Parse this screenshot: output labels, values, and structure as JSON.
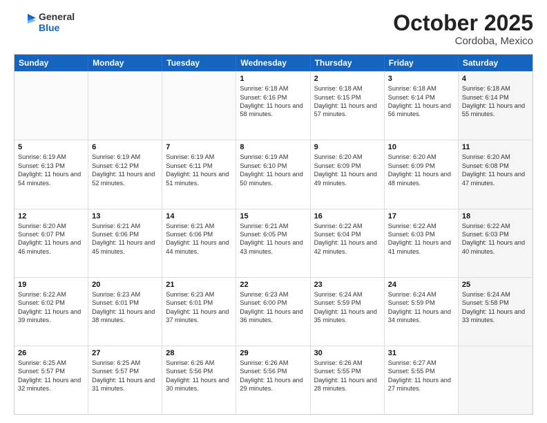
{
  "header": {
    "logo_general": "General",
    "logo_blue": "Blue",
    "month": "October 2025",
    "location": "Cordoba, Mexico"
  },
  "days_of_week": [
    "Sunday",
    "Monday",
    "Tuesday",
    "Wednesday",
    "Thursday",
    "Friday",
    "Saturday"
  ],
  "weeks": [
    [
      {
        "day": "",
        "sunrise": "",
        "sunset": "",
        "daylight": "",
        "shaded": false,
        "empty": true
      },
      {
        "day": "",
        "sunrise": "",
        "sunset": "",
        "daylight": "",
        "shaded": false,
        "empty": true
      },
      {
        "day": "",
        "sunrise": "",
        "sunset": "",
        "daylight": "",
        "shaded": false,
        "empty": true
      },
      {
        "day": "1",
        "sunrise": "Sunrise: 6:18 AM",
        "sunset": "Sunset: 6:16 PM",
        "daylight": "Daylight: 11 hours and 58 minutes.",
        "shaded": false,
        "empty": false
      },
      {
        "day": "2",
        "sunrise": "Sunrise: 6:18 AM",
        "sunset": "Sunset: 6:15 PM",
        "daylight": "Daylight: 11 hours and 57 minutes.",
        "shaded": false,
        "empty": false
      },
      {
        "day": "3",
        "sunrise": "Sunrise: 6:18 AM",
        "sunset": "Sunset: 6:14 PM",
        "daylight": "Daylight: 11 hours and 56 minutes.",
        "shaded": false,
        "empty": false
      },
      {
        "day": "4",
        "sunrise": "Sunrise: 6:18 AM",
        "sunset": "Sunset: 6:14 PM",
        "daylight": "Daylight: 11 hours and 55 minutes.",
        "shaded": true,
        "empty": false
      }
    ],
    [
      {
        "day": "5",
        "sunrise": "Sunrise: 6:19 AM",
        "sunset": "Sunset: 6:13 PM",
        "daylight": "Daylight: 11 hours and 54 minutes.",
        "shaded": false,
        "empty": false
      },
      {
        "day": "6",
        "sunrise": "Sunrise: 6:19 AM",
        "sunset": "Sunset: 6:12 PM",
        "daylight": "Daylight: 11 hours and 52 minutes.",
        "shaded": false,
        "empty": false
      },
      {
        "day": "7",
        "sunrise": "Sunrise: 6:19 AM",
        "sunset": "Sunset: 6:11 PM",
        "daylight": "Daylight: 11 hours and 51 minutes.",
        "shaded": false,
        "empty": false
      },
      {
        "day": "8",
        "sunrise": "Sunrise: 6:19 AM",
        "sunset": "Sunset: 6:10 PM",
        "daylight": "Daylight: 11 hours and 50 minutes.",
        "shaded": false,
        "empty": false
      },
      {
        "day": "9",
        "sunrise": "Sunrise: 6:20 AM",
        "sunset": "Sunset: 6:09 PM",
        "daylight": "Daylight: 11 hours and 49 minutes.",
        "shaded": false,
        "empty": false
      },
      {
        "day": "10",
        "sunrise": "Sunrise: 6:20 AM",
        "sunset": "Sunset: 6:09 PM",
        "daylight": "Daylight: 11 hours and 48 minutes.",
        "shaded": false,
        "empty": false
      },
      {
        "day": "11",
        "sunrise": "Sunrise: 6:20 AM",
        "sunset": "Sunset: 6:08 PM",
        "daylight": "Daylight: 11 hours and 47 minutes.",
        "shaded": true,
        "empty": false
      }
    ],
    [
      {
        "day": "12",
        "sunrise": "Sunrise: 6:20 AM",
        "sunset": "Sunset: 6:07 PM",
        "daylight": "Daylight: 11 hours and 46 minutes.",
        "shaded": false,
        "empty": false
      },
      {
        "day": "13",
        "sunrise": "Sunrise: 6:21 AM",
        "sunset": "Sunset: 6:06 PM",
        "daylight": "Daylight: 11 hours and 45 minutes.",
        "shaded": false,
        "empty": false
      },
      {
        "day": "14",
        "sunrise": "Sunrise: 6:21 AM",
        "sunset": "Sunset: 6:06 PM",
        "daylight": "Daylight: 11 hours and 44 minutes.",
        "shaded": false,
        "empty": false
      },
      {
        "day": "15",
        "sunrise": "Sunrise: 6:21 AM",
        "sunset": "Sunset: 6:05 PM",
        "daylight": "Daylight: 11 hours and 43 minutes.",
        "shaded": false,
        "empty": false
      },
      {
        "day": "16",
        "sunrise": "Sunrise: 6:22 AM",
        "sunset": "Sunset: 6:04 PM",
        "daylight": "Daylight: 11 hours and 42 minutes.",
        "shaded": false,
        "empty": false
      },
      {
        "day": "17",
        "sunrise": "Sunrise: 6:22 AM",
        "sunset": "Sunset: 6:03 PM",
        "daylight": "Daylight: 11 hours and 41 minutes.",
        "shaded": false,
        "empty": false
      },
      {
        "day": "18",
        "sunrise": "Sunrise: 6:22 AM",
        "sunset": "Sunset: 6:03 PM",
        "daylight": "Daylight: 11 hours and 40 minutes.",
        "shaded": true,
        "empty": false
      }
    ],
    [
      {
        "day": "19",
        "sunrise": "Sunrise: 6:22 AM",
        "sunset": "Sunset: 6:02 PM",
        "daylight": "Daylight: 11 hours and 39 minutes.",
        "shaded": false,
        "empty": false
      },
      {
        "day": "20",
        "sunrise": "Sunrise: 6:23 AM",
        "sunset": "Sunset: 6:01 PM",
        "daylight": "Daylight: 11 hours and 38 minutes.",
        "shaded": false,
        "empty": false
      },
      {
        "day": "21",
        "sunrise": "Sunrise: 6:23 AM",
        "sunset": "Sunset: 6:01 PM",
        "daylight": "Daylight: 11 hours and 37 minutes.",
        "shaded": false,
        "empty": false
      },
      {
        "day": "22",
        "sunrise": "Sunrise: 6:23 AM",
        "sunset": "Sunset: 6:00 PM",
        "daylight": "Daylight: 11 hours and 36 minutes.",
        "shaded": false,
        "empty": false
      },
      {
        "day": "23",
        "sunrise": "Sunrise: 6:24 AM",
        "sunset": "Sunset: 5:59 PM",
        "daylight": "Daylight: 11 hours and 35 minutes.",
        "shaded": false,
        "empty": false
      },
      {
        "day": "24",
        "sunrise": "Sunrise: 6:24 AM",
        "sunset": "Sunset: 5:59 PM",
        "daylight": "Daylight: 11 hours and 34 minutes.",
        "shaded": false,
        "empty": false
      },
      {
        "day": "25",
        "sunrise": "Sunrise: 6:24 AM",
        "sunset": "Sunset: 5:58 PM",
        "daylight": "Daylight: 11 hours and 33 minutes.",
        "shaded": true,
        "empty": false
      }
    ],
    [
      {
        "day": "26",
        "sunrise": "Sunrise: 6:25 AM",
        "sunset": "Sunset: 5:57 PM",
        "daylight": "Daylight: 11 hours and 32 minutes.",
        "shaded": false,
        "empty": false
      },
      {
        "day": "27",
        "sunrise": "Sunrise: 6:25 AM",
        "sunset": "Sunset: 5:57 PM",
        "daylight": "Daylight: 11 hours and 31 minutes.",
        "shaded": false,
        "empty": false
      },
      {
        "day": "28",
        "sunrise": "Sunrise: 6:26 AM",
        "sunset": "Sunset: 5:56 PM",
        "daylight": "Daylight: 11 hours and 30 minutes.",
        "shaded": false,
        "empty": false
      },
      {
        "day": "29",
        "sunrise": "Sunrise: 6:26 AM",
        "sunset": "Sunset: 5:56 PM",
        "daylight": "Daylight: 11 hours and 29 minutes.",
        "shaded": false,
        "empty": false
      },
      {
        "day": "30",
        "sunrise": "Sunrise: 6:26 AM",
        "sunset": "Sunset: 5:55 PM",
        "daylight": "Daylight: 11 hours and 28 minutes.",
        "shaded": false,
        "empty": false
      },
      {
        "day": "31",
        "sunrise": "Sunrise: 6:27 AM",
        "sunset": "Sunset: 5:55 PM",
        "daylight": "Daylight: 11 hours and 27 minutes.",
        "shaded": false,
        "empty": false
      },
      {
        "day": "",
        "sunrise": "",
        "sunset": "",
        "daylight": "",
        "shaded": true,
        "empty": true
      }
    ]
  ]
}
